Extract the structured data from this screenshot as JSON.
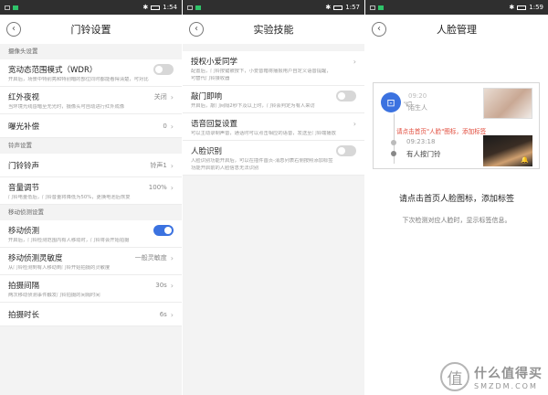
{
  "status": {
    "p1_time": "1:54",
    "p2_time": "1:57",
    "p3_time": "1:59"
  },
  "panel1": {
    "title": "门铃设置",
    "sections": {
      "camera": "摄像头设置",
      "ring": "铃声设置",
      "motion": "移动侦测设置"
    },
    "wdr": {
      "label": "宽动态范围模式（WDR）",
      "desc": "开启后，场景中特别亮和特别暗的部位同时都能看得清楚，可对比",
      "toggle": "off"
    },
    "night": {
      "label": "红外夜视",
      "value": "关闭",
      "desc": "当环境光线昏暗至无光时，摄像头可自动进行红外成像"
    },
    "exposure": {
      "label": "曝光补偿",
      "value": "0"
    },
    "ringtone": {
      "label": "门铃铃声",
      "value": "铃声1"
    },
    "volume": {
      "label": "音量调节",
      "value": "100%",
      "desc": "门铃电量低后，门铃音量将降低为50%，更换电池后恢复"
    },
    "motion": {
      "label": "移动侦测",
      "desc": "开启后，门铃检测范围内有人移动时，门铃将会开始拍摄",
      "toggle": "on"
    },
    "sensitivity": {
      "label": "移动侦测灵敏度",
      "value": "一般灵敏度",
      "desc": "从门铃检测到有人移动到门铃开始拍摄的灵敏度"
    },
    "interval": {
      "label": "拍摄间隔",
      "value": "30s",
      "desc": "两次移动侦测事件触发门铃拍摄的间隔时间"
    },
    "duration": {
      "label": "拍摄时长",
      "value": "6s"
    }
  },
  "panel2": {
    "title": "实验技能",
    "auth": {
      "label": "授权小爱同学",
      "desc1": "配置后，门铃按键被按下，小爱音箱将播报用户自定义语音提醒，",
      "desc2": "可替代门铃接收器"
    },
    "knock": {
      "label": "敲门即响",
      "desc": "开启后，敲门间隔2秒下及以上时，门铃会判定为有人来访",
      "toggle": "off"
    },
    "voice": {
      "label": "语音回复设置",
      "desc": "可以主动录制声音，通话时可以点击相应的语音，发送至门铃端播放"
    },
    "face": {
      "label": "人脸识别",
      "desc1": "人脸识别功能开启后，可以在插件首页-消息列表右侧按照添加标签",
      "desc2": "功能开启前的人脸信息无法识别",
      "toggle": "off"
    }
  },
  "panel3": {
    "title": "人脸管理",
    "demo": {
      "ev1_time": "09:20",
      "ev1_name": "陌生人",
      "hint": "请点击首页\"人脸\"图标，添加标签",
      "ev2_time": "09:23:18",
      "ev2_name": "有人按门铃"
    },
    "main_hint": "请点击首页人脸图标，添加标签",
    "sub_hint": "下次检测对应人脸时，显示标签信息。"
  },
  "watermark": {
    "logo_char": "值",
    "text": "什么值得买",
    "sub": "SMZDM.COM"
  },
  "icons": {
    "back": "chevron-left-icon",
    "chevron": "chevron-right-icon",
    "face_scan": "face-scan-icon",
    "hand": "pointer-hand-icon"
  },
  "colors": {
    "accent": "#3b72e0",
    "hint_red": "#e14a3a"
  }
}
